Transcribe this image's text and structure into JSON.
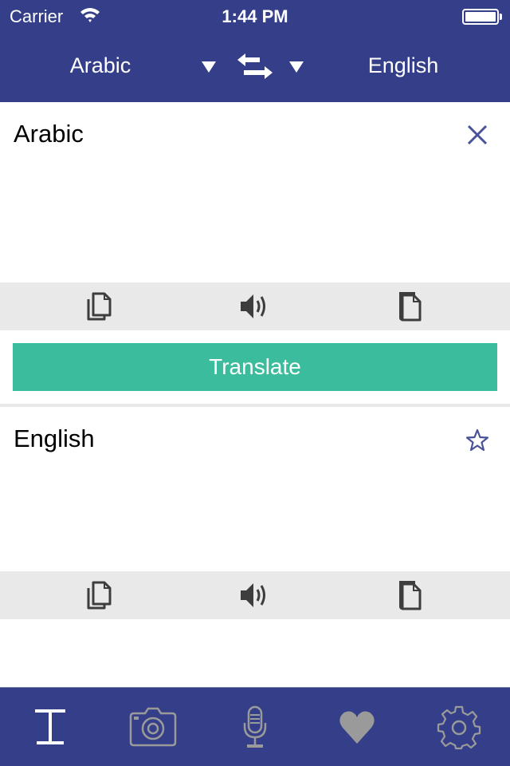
{
  "status_bar": {
    "carrier": "Carrier",
    "time": "1:44 PM",
    "wifi_icon": "wifi-icon",
    "battery_icon": "battery-icon",
    "battery_level": 1.0
  },
  "header": {
    "source_language": "Arabic",
    "target_language": "English",
    "swap_icon": "swap-arrows-icon",
    "dropdown_icon": "triangle-down-icon"
  },
  "input_panel": {
    "label": "Arabic",
    "clear_icon": "close-icon"
  },
  "output_panel": {
    "label": "English",
    "favorite_icon": "star-outline-icon"
  },
  "action_bar": {
    "copy_icon": "copy-icon",
    "speak_icon": "speaker-icon",
    "paste_icon": "paste-icon"
  },
  "translate_button": {
    "label": "Translate"
  },
  "tab_bar": {
    "tabs": [
      {
        "id": "text",
        "icon": "text-cursor-icon",
        "active": true
      },
      {
        "id": "camera",
        "icon": "camera-icon",
        "active": false
      },
      {
        "id": "voice",
        "icon": "microphone-icon",
        "active": false
      },
      {
        "id": "favorites",
        "icon": "heart-icon",
        "active": false
      },
      {
        "id": "settings",
        "icon": "gear-icon",
        "active": false
      }
    ]
  },
  "colors": {
    "header_bg": "#353f89",
    "accent_green": "#3bbc9c",
    "action_bar_bg": "#e9e9e9",
    "icon_dark": "#3d3d3d",
    "icon_blue": "#4a5299",
    "inactive_tab": "#9a9a9a"
  }
}
